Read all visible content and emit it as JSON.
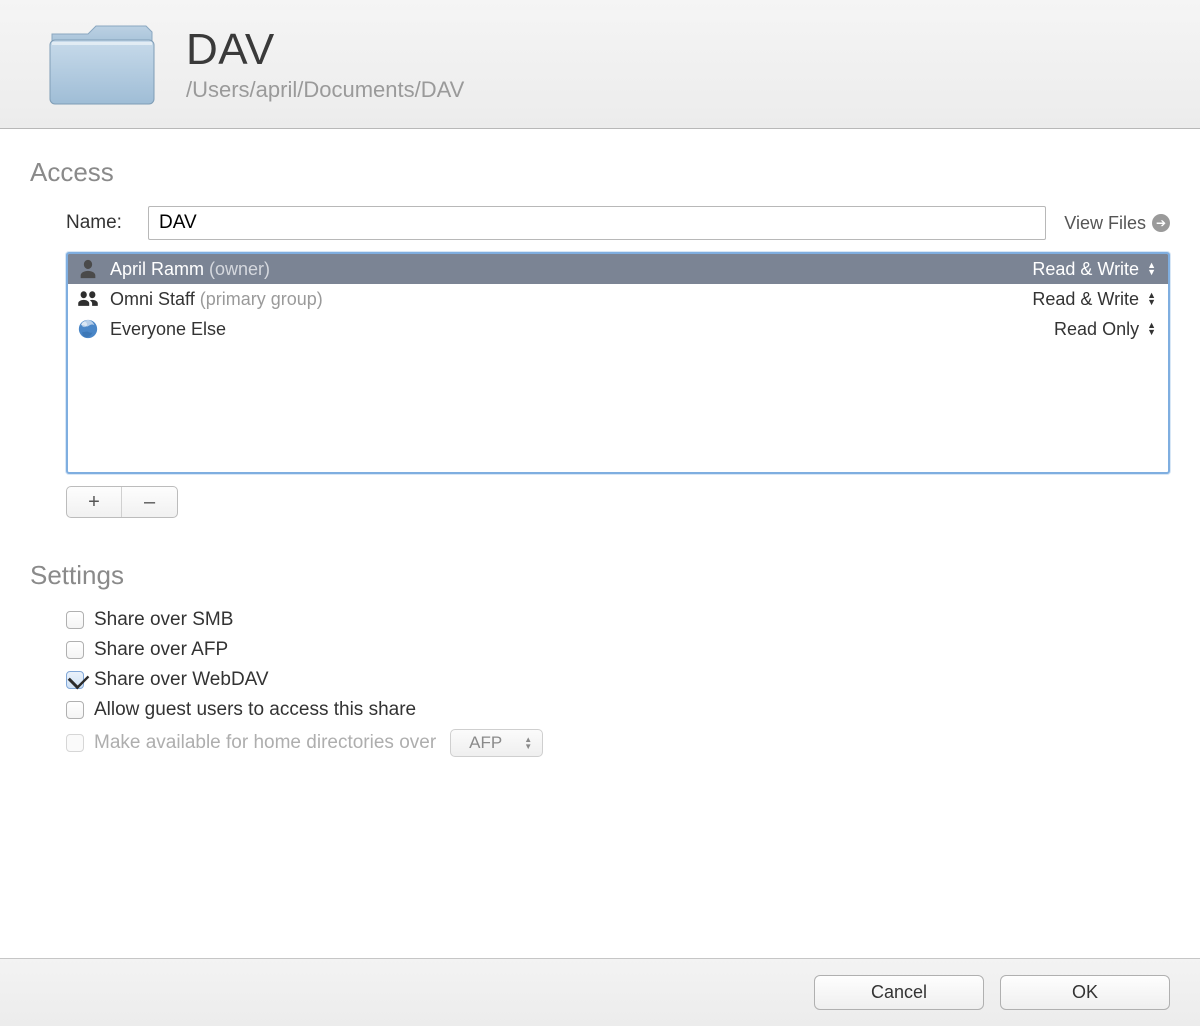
{
  "header": {
    "title": "DAV",
    "path": "/Users/april/Documents/DAV"
  },
  "access": {
    "section_label": "Access",
    "name_label": "Name:",
    "name_value": "DAV",
    "view_files_label": "View Files",
    "permissions": [
      {
        "name": "April Ramm",
        "note": "(owner)",
        "level": "Read & Write",
        "icon": "person",
        "selected": true
      },
      {
        "name": "Omni Staff",
        "note": "(primary group)",
        "level": "Read & Write",
        "icon": "group",
        "selected": false
      },
      {
        "name": "Everyone Else",
        "note": "",
        "level": "Read Only",
        "icon": "globe",
        "selected": false
      }
    ],
    "add_label": "+",
    "remove_label": "–"
  },
  "settings": {
    "section_label": "Settings",
    "options": [
      {
        "label": "Share over SMB",
        "checked": false,
        "disabled": false
      },
      {
        "label": "Share over AFP",
        "checked": false,
        "disabled": false
      },
      {
        "label": "Share over WebDAV",
        "checked": true,
        "disabled": false
      },
      {
        "label": "Allow guest users to access this share",
        "checked": false,
        "disabled": false
      },
      {
        "label": "Make available for home directories over",
        "checked": false,
        "disabled": true
      }
    ],
    "home_dir_protocol": "AFP"
  },
  "footer": {
    "cancel_label": "Cancel",
    "ok_label": "OK"
  }
}
